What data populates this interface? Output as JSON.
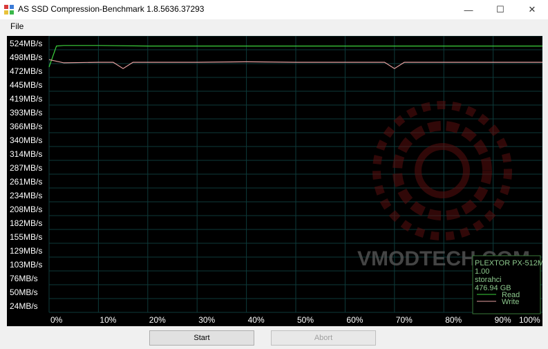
{
  "window": {
    "title": "AS SSD Compression-Benchmark 1.8.5636.37293",
    "minimize_glyph": "—",
    "maximize_glyph": "☐",
    "close_glyph": "✕"
  },
  "menu": {
    "file_label": "File"
  },
  "buttons": {
    "start_label": "Start",
    "abort_label": "Abort"
  },
  "watermark": {
    "text": "VMODTECH.COM"
  },
  "info_box": {
    "device": "PLEXTOR PX-512M",
    "firmware": "1.00",
    "driver": "storahci",
    "capacity": "476.94 GB",
    "read_label": "Read",
    "write_label": "Write"
  },
  "colors": {
    "read": "#3cd23c",
    "write": "#e6a0a0",
    "grid": "#0e3a3a",
    "axis_text": "#ffffff",
    "info_text": "#8cc88c"
  },
  "chart_data": {
    "type": "line",
    "x_ticks": [
      "0%",
      "10%",
      "20%",
      "30%",
      "40%",
      "50%",
      "60%",
      "70%",
      "80%",
      "90%",
      "100%"
    ],
    "y_ticks": [
      "524MB/s",
      "498MB/s",
      "472MB/s",
      "445MB/s",
      "419MB/s",
      "393MB/s",
      "366MB/s",
      "340MB/s",
      "314MB/s",
      "287MB/s",
      "261MB/s",
      "234MB/s",
      "208MB/s",
      "182MB/s",
      "155MB/s",
      "129MB/s",
      "103MB/s",
      "76MB/s",
      "50MB/s",
      "24MB/s"
    ],
    "ylim": [
      0,
      550
    ],
    "xlim": [
      0,
      100
    ],
    "grid": true,
    "legend_position": "bottom-right",
    "series": [
      {
        "name": "Read",
        "color": "#3cd23c",
        "x": [
          0,
          1.5,
          3,
          10,
          20,
          30,
          40,
          50,
          60,
          70,
          80,
          90,
          100
        ],
        "y": [
          478,
          518,
          519,
          519,
          518,
          518,
          518,
          518,
          518,
          518,
          518,
          518,
          518
        ]
      },
      {
        "name": "Write",
        "color": "#e6a0a0",
        "x": [
          0,
          1,
          3,
          10,
          13,
          15,
          17,
          20,
          30,
          40,
          50,
          60,
          68,
          70,
          72,
          80,
          90,
          100
        ],
        "y": [
          492,
          490,
          486,
          487,
          487,
          475,
          487,
          487,
          487,
          488,
          487,
          487,
          487,
          475,
          487,
          487,
          487,
          487
        ]
      }
    ]
  }
}
